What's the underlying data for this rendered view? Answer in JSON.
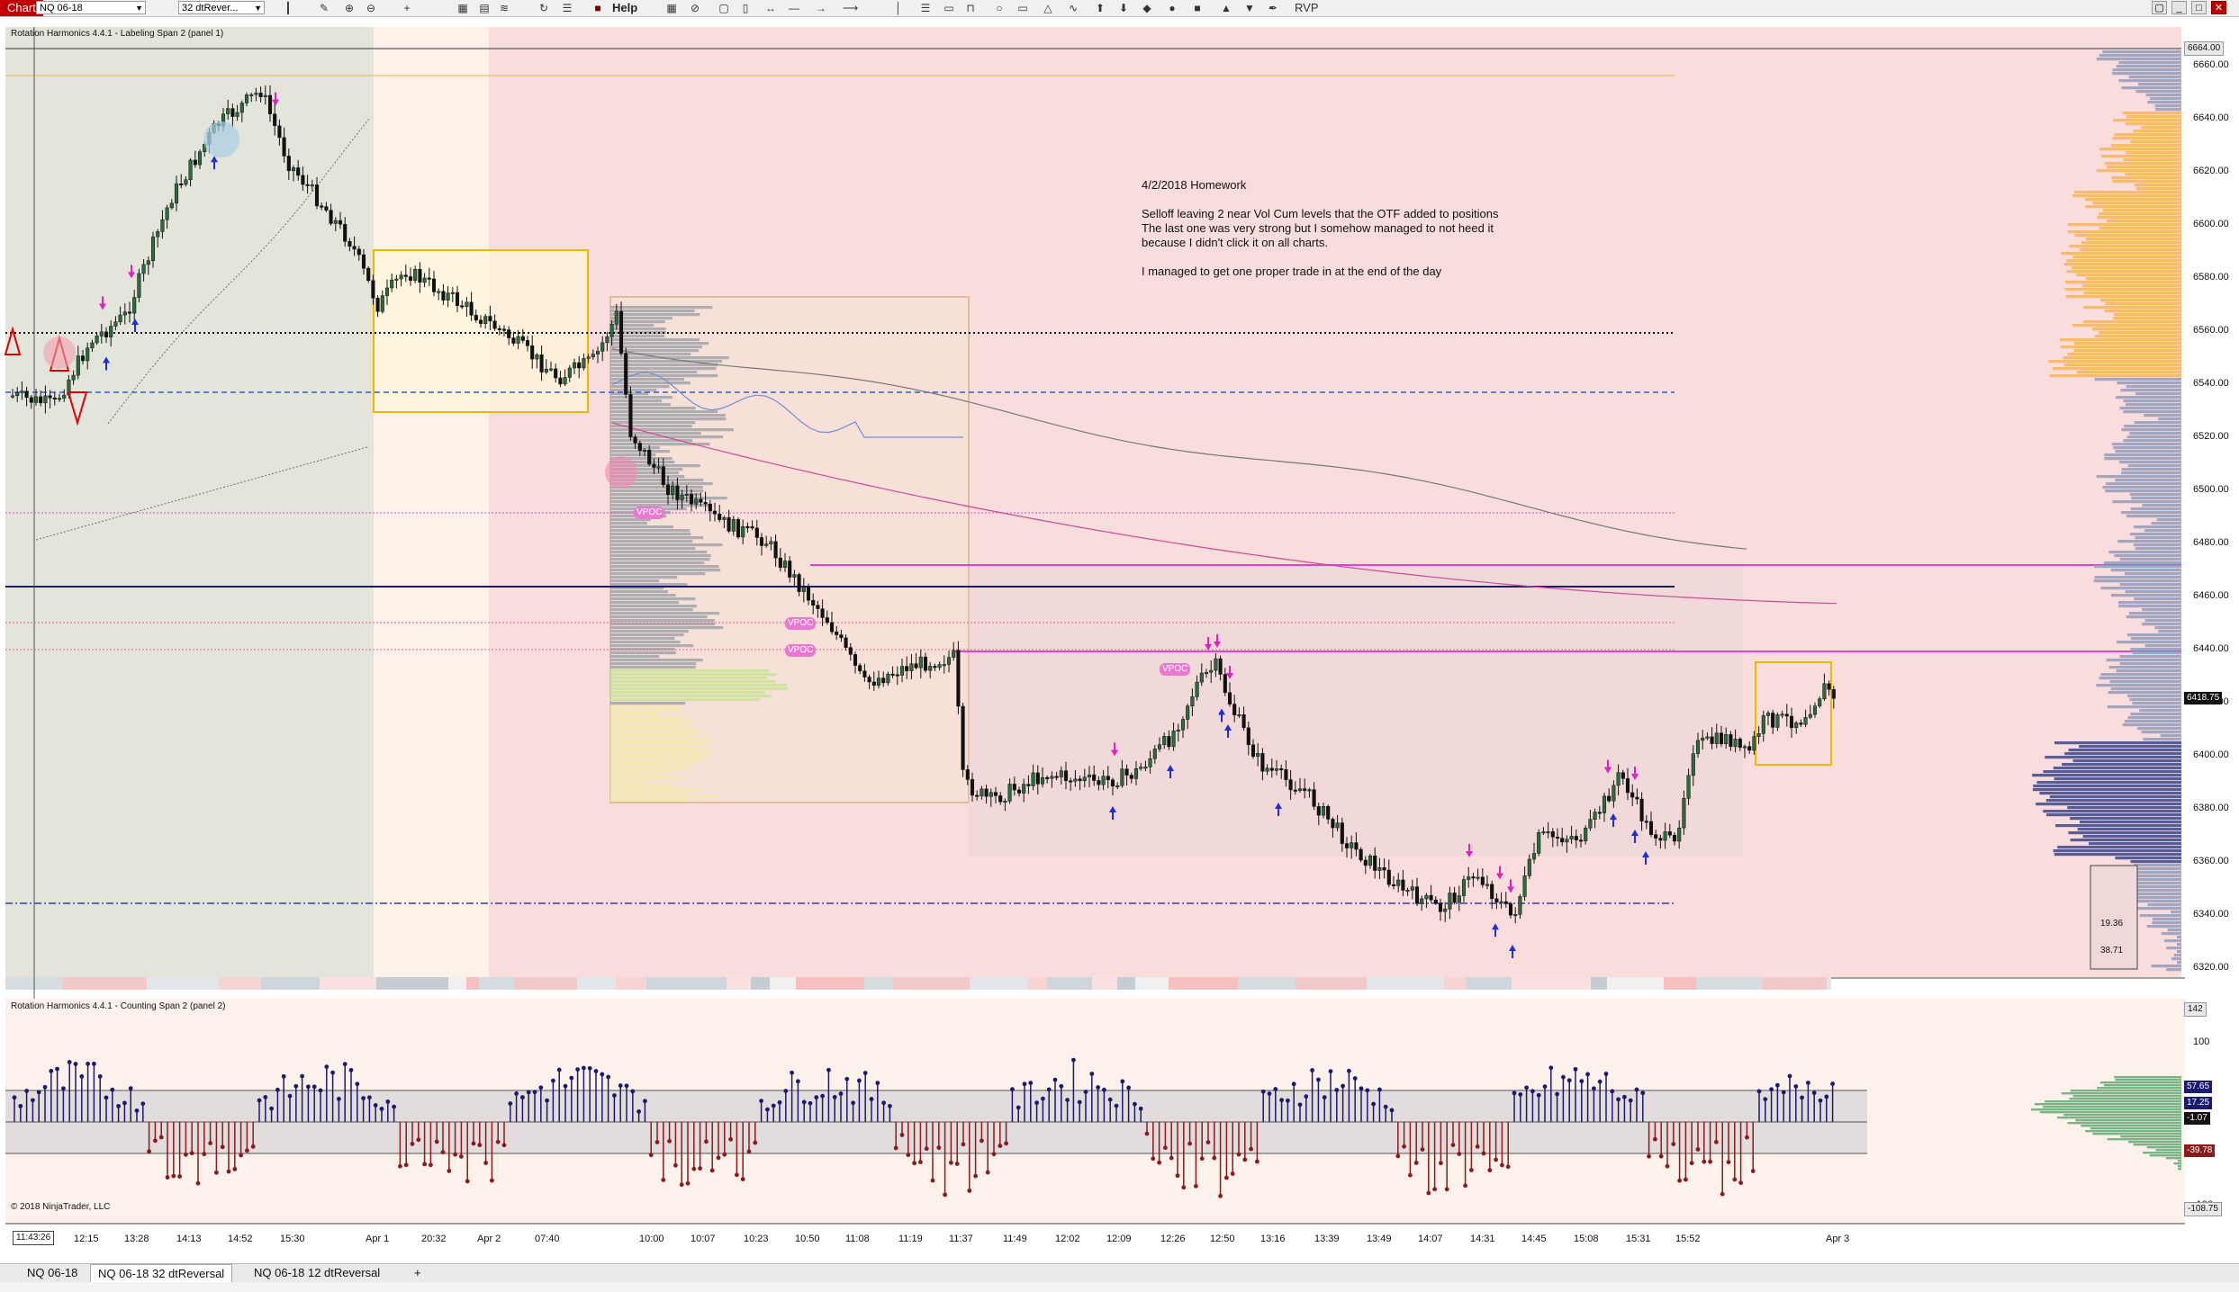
{
  "toolbar": {
    "chart_button": "Chart",
    "instrument": "NQ 06-18",
    "bars_type": "32 dtRever...",
    "help": "Help",
    "rvp": "RVP"
  },
  "panels": {
    "price_label": "Rotation Harmonics 4.4.1 - Labeling Span 2  (panel 1)",
    "counting_label": "Rotation Harmonics 4.4.1 - Counting Span 2  (panel 2)",
    "copyright": "© 2018 NinjaTrader, LLC"
  },
  "note": {
    "title": "4/2/2018 Homework",
    "line1": "Selloff leaving 2 near Vol Cum levels that the OTF added to positions",
    "line2": "The last one was very strong but I somehow managed to not heed it",
    "line3": "because I didn't click it on all charts.",
    "line4": "I managed to get one proper trade in at the end of the day"
  },
  "price_axis": {
    "labels": [
      "6660.00",
      "6640.00",
      "6620.00",
      "6600.00",
      "6580.00",
      "6560.00",
      "6540.00",
      "6520.00",
      "6500.00",
      "6480.00",
      "6460.00",
      "6440.00",
      "6420.00",
      "6400.00",
      "6380.00",
      "6360.00",
      "6340.00",
      "6320.00"
    ],
    "top_price": "6664.00",
    "last_price": "6418.75"
  },
  "counting_axis": {
    "labels": [
      "142",
      "100",
      "57.65",
      "17.25",
      "-1.07",
      "-39.78",
      "-100",
      "-108.75"
    ]
  },
  "volume_box": {
    "value1": "19.36",
    "value2": "38.71"
  },
  "vpoc_labels": [
    "VPOC",
    "VPOC",
    "VPOC",
    "VPOC"
  ],
  "time_axis": {
    "current": "11:43:26",
    "labels": [
      "12:15",
      "13:28",
      "14:13",
      "14:52",
      "15:30",
      "Apr 1",
      "20:32",
      "Apr 2",
      "07:40",
      "10:00",
      "10:07",
      "10:23",
      "10:50",
      "11:08",
      "11:19",
      "11:37",
      "11:49",
      "12:02",
      "12:09",
      "12:26",
      "12:50",
      "13:16",
      "13:39",
      "13:49",
      "14:07",
      "14:31",
      "14:45",
      "15:08",
      "15:31",
      "15:52",
      "Apr 3"
    ]
  },
  "tabs": [
    "NQ 06-18",
    "NQ 06-18 32 dtReversal",
    "NQ 06-18 12 dtReversal",
    "+"
  ],
  "colors": {
    "up_bar": "#1f5f2f",
    "down_bar": "#111111",
    "bg_early": "#e4e6dc",
    "bg_mid": "#fdf0ea",
    "bg_main": "#f9dcdc",
    "counting_up": "#1a1a6e",
    "counting_down": "#8b1a1a",
    "accent": "#c00000"
  }
}
